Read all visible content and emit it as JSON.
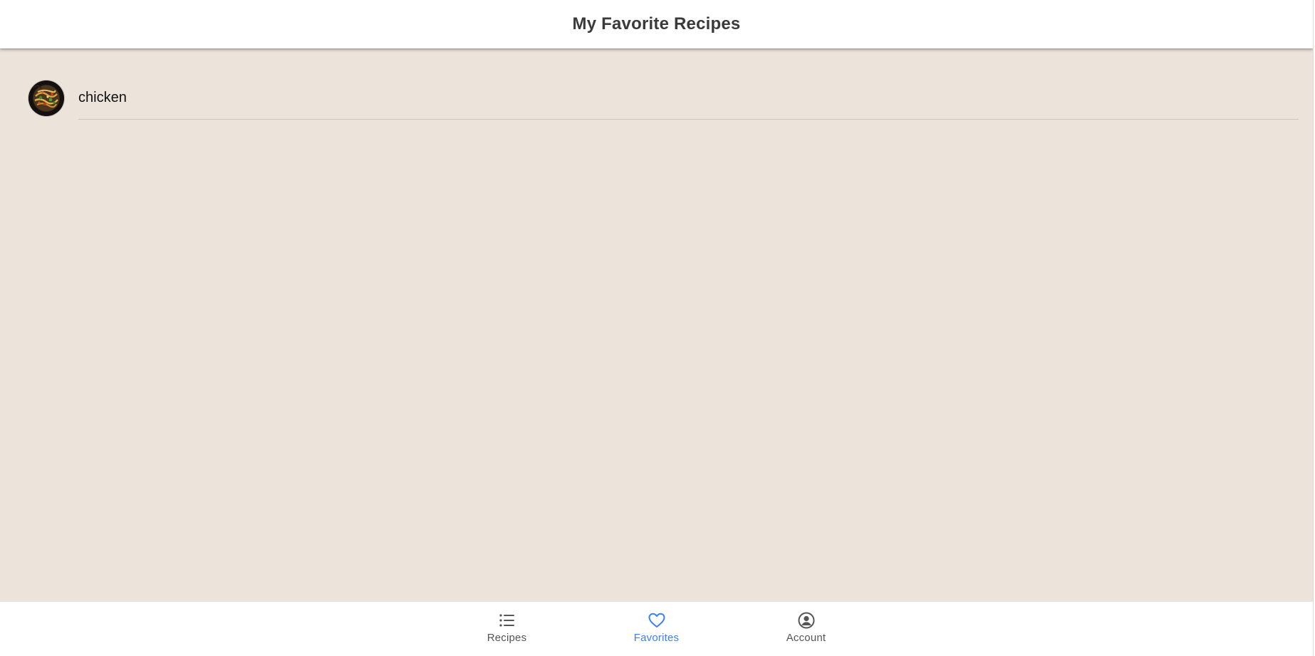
{
  "header": {
    "title": "My Favorite Recipes"
  },
  "favorites": {
    "items": [
      {
        "label": "chicken",
        "thumbnail_icon": "recipe-thumbnail"
      }
    ]
  },
  "tabs": [
    {
      "label": "Recipes",
      "icon": "list-icon",
      "active": false
    },
    {
      "label": "Favorites",
      "icon": "heart-icon",
      "active": true
    },
    {
      "label": "Account",
      "icon": "person-circle-icon",
      "active": false
    }
  ],
  "colors": {
    "accent": "#3880ff",
    "content_background": "#ece3db",
    "inactive_tab": "#555555"
  }
}
